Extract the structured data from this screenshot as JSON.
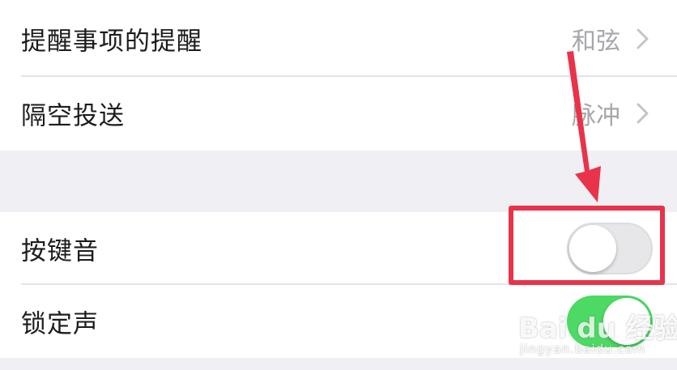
{
  "colors": {
    "background": "#efeff4",
    "cell": "#ffffff",
    "label": "#1c1c1e",
    "value": "#a6a6ab",
    "switch_on": "#4cd964",
    "switch_off": "#e7e7ea",
    "annotation": "#e8334a"
  },
  "settings": {
    "rows": [
      {
        "label": "提醒事项的提醒",
        "value": "和弦",
        "icon": "chevron-right-icon"
      },
      {
        "label": "隔空投送",
        "value": "脉冲",
        "icon": "chevron-right-icon"
      },
      {
        "label": "按键音",
        "toggle": false
      },
      {
        "label": "锁定声",
        "toggle": true
      }
    ]
  },
  "watermark": {
    "brand": "Bai du 经验",
    "url": "jingyan.baidu.com"
  }
}
